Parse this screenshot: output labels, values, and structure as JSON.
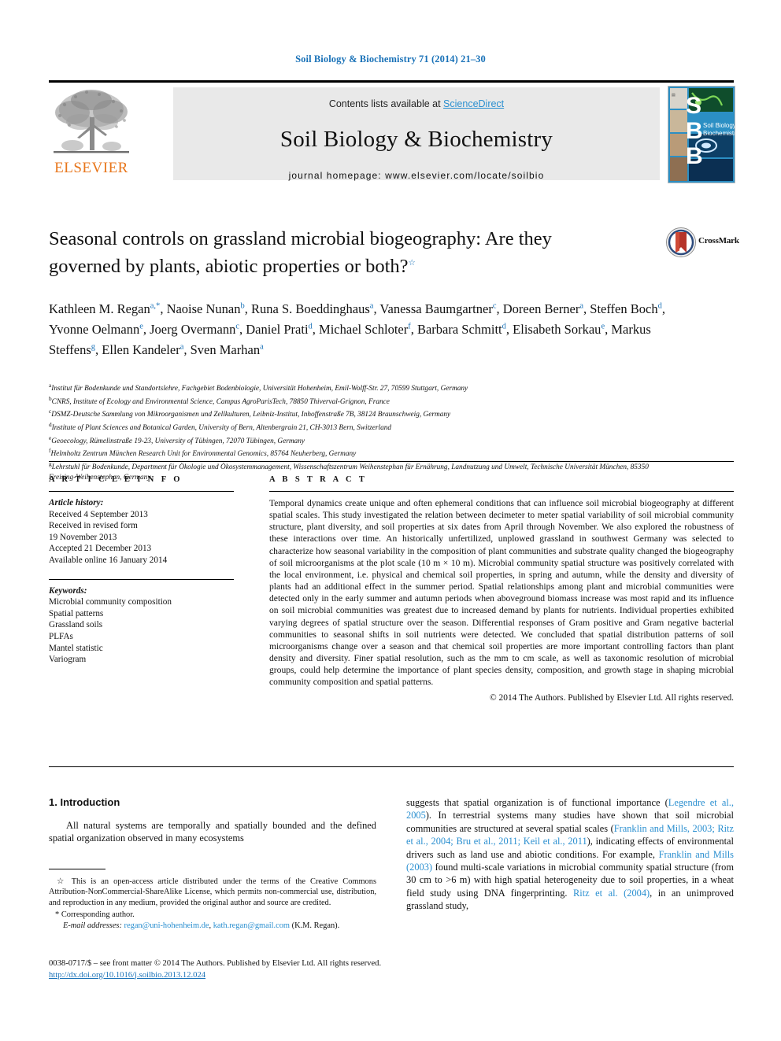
{
  "running_head": "Soil Biology & Biochemistry 71 (2014) 21–30",
  "masthead": {
    "contents_prefix": "Contents lists available at ",
    "sciencedirect": "ScienceDirect",
    "journal_title": "Soil Biology & Biochemistry",
    "homepage": "journal homepage: www.elsevier.com/locate/soilbio",
    "publisher": "ELSEVIER",
    "cover_letters": [
      "S",
      "B",
      "B"
    ],
    "cover_title_line1": "Soil Biology &",
    "cover_title_line2": "Biochemistry"
  },
  "crossmark": {
    "label": "CrossMark"
  },
  "article": {
    "title_line1": "Seasonal controls on grassland microbial biogeography: Are they",
    "title_line2": "governed by plants, abiotic properties or both?",
    "title_marker": "☆",
    "authors_html": "Kathleen M. Regan<sup class=\"aff\">a,*</sup>, Naoise Nunan<sup class=\"aff\">b</sup>, Runa S. Boeddinghaus<sup class=\"aff\">a</sup>, Vanessa Baumgartner<sup class=\"aff\">c</sup>, Doreen Berner<sup class=\"aff\">a</sup>, Steffen Boch<sup class=\"aff\">d</sup>, Yvonne Oelmann<sup class=\"aff\">e</sup>, Joerg Overmann<sup class=\"aff\">c</sup>, Daniel Prati<sup class=\"aff\">d</sup>, Michael Schloter<sup class=\"aff\">f</sup>, Barbara Schmitt<sup class=\"aff\">d</sup>, Elisabeth Sorkau<sup class=\"aff\">e</sup>, Markus Steffens<sup class=\"aff\">g</sup>, Ellen Kandeler<sup class=\"aff\">a</sup>, Sven Marhan<sup class=\"aff\">a</sup>",
    "affiliations": [
      {
        "key": "a",
        "text": "Institut für Bodenkunde und Standortslehre, Fachgebiet Bodenbiologie, Universität Hohenheim, Emil-Wolff-Str. 27, 70599 Stuttgart, Germany"
      },
      {
        "key": "b",
        "text": "CNRS, Institute of Ecology and Environmental Science, Campus AgroParisTech, 78850 Thiverval-Grignon, France"
      },
      {
        "key": "c",
        "text": "DSMZ-Deutsche Sammlung von Mikroorganismen und Zellkulturen, Leibniz-Institut, Inhoffenstraße 7B, 38124 Braunschweig, Germany"
      },
      {
        "key": "d",
        "text": "Institute of Plant Sciences and Botanical Garden, University of Bern, Altenbergrain 21, CH-3013 Bern, Switzerland"
      },
      {
        "key": "e",
        "text": "Geoecology, Rümelinstraße 19-23, University of Tübingen, 72070 Tübingen, Germany"
      },
      {
        "key": "f",
        "text": "Helmholtz Zentrum München Research Unit for Environmental Genomics, 85764 Neuherberg, Germany"
      },
      {
        "key": "g",
        "text": "Lehrstuhl für Bodenkunde, Department für Ökologie und Ökosystemmanagement, Wissenschaftszentrum Weihenstephan für Ernährung, Landnutzung und Umwelt, Technische Universität München, 85350 Freising-Weihenstephan, Germany"
      }
    ]
  },
  "article_info": {
    "heading": "A R T I C L E  I N F O",
    "history_label": "Article history:",
    "history": [
      "Received 4 September 2013",
      "Received in revised form",
      "19 November 2013",
      "Accepted 21 December 2013",
      "Available online 16 January 2014"
    ],
    "keywords_label": "Keywords:",
    "keywords": [
      "Microbial community composition",
      "Spatial patterns",
      "Grassland soils",
      "PLFAs",
      "Mantel statistic",
      "Variogram"
    ]
  },
  "abstract": {
    "heading": "A B S T R A C T",
    "text": "Temporal dynamics create unique and often ephemeral conditions that can influence soil microbial biogeography at different spatial scales. This study investigated the relation between decimeter to meter spatial variability of soil microbial community structure, plant diversity, and soil properties at six dates from April through November. We also explored the robustness of these interactions over time. An historically unfertilized, unplowed grassland in southwest Germany was selected to characterize how seasonal variability in the composition of plant communities and substrate quality changed the biogeography of soil microorganisms at the plot scale (10 m × 10 m). Microbial community spatial structure was positively correlated with the local environment, i.e. physical and chemical soil properties, in spring and autumn, while the density and diversity of plants had an additional effect in the summer period. Spatial relationships among plant and microbial communities were detected only in the early summer and autumn periods when aboveground biomass increase was most rapid and its influence on soil microbial communities was greatest due to increased demand by plants for nutrients. Individual properties exhibited varying degrees of spatial structure over the season. Differential responses of Gram positive and Gram negative bacterial communities to seasonal shifts in soil nutrients were detected. We concluded that spatial distribution patterns of soil microorganisms change over a season and that chemical soil properties are more important controlling factors than plant density and diversity. Finer spatial resolution, such as the mm to cm scale, as well as taxonomic resolution of microbial groups, could help determine the importance of plant species density, composition, and growth stage in shaping microbial community composition and spatial patterns.",
    "copyright": "© 2014 The Authors. Published by Elsevier Ltd. All rights reserved."
  },
  "introduction": {
    "heading": "1. Introduction",
    "left_paragraph": "All natural systems are temporally and spatially bounded and the defined spatial organization observed in many ecosystems",
    "right_html": "suggests that spatial organization is of functional importance (<span class=\"ref\">Legendre et al., 2005</span>). In terrestrial systems many studies have shown that soil microbial communities are structured at several spatial scales (<span class=\"ref\">Franklin and Mills, 2003; Ritz et al., 2004; Bru et al., 2011; Keil et al., 2011</span>), indicating effects of environmental drivers such as land use and abiotic conditions. For example, <span class=\"ref\">Franklin and Mills (2003)</span> found multi-scale variations in microbial community spatial structure (from 30 cm to &gt;6 m) with high spatial heterogeneity due to soil properties, in a wheat field study using DNA fingerprinting. <span class=\"ref\">Ritz et al. (2004)</span>, in an unimproved grassland study,"
  },
  "footnotes": {
    "open_access_marker": "☆",
    "open_access": "This is an open-access article distributed under the terms of the Creative Commons Attribution-NonCommercial-ShareAlike License, which permits non-commercial use, distribution, and reproduction in any medium, provided the original author and source are credited.",
    "corresponding_marker": "*",
    "corresponding": "Corresponding author.",
    "email_label": "E-mail addresses:",
    "email1": "regan@uni-hohenheim.de",
    "email2": "kath.regan@gmail.com",
    "email_suffix": "(K.M. Regan)."
  },
  "colophon": {
    "line1": "0038-0717/$ – see front matter © 2014 The Authors. Published by Elsevier Ltd. All rights reserved.",
    "doi": "http://dx.doi.org/10.1016/j.soilbio.2013.12.024"
  },
  "colors": {
    "link_blue": "#2a8fd0",
    "head_blue": "#1a72b8",
    "elsevier_orange": "#e8761b",
    "banner_gray": "#e9e9e9",
    "cover_blue": "#2b8fc4"
  }
}
